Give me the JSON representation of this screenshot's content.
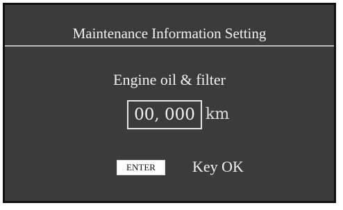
{
  "screen": {
    "title": "Maintenance Information Setting",
    "item_label": "Engine oil & filter",
    "distance_value": "00, 000",
    "distance_unit": "km",
    "enter_key_label": "ENTER",
    "enter_hint": "Key OK"
  },
  "colors": {
    "background": "#3b3b3b",
    "text": "#f2f2f2",
    "key_background": "#ffffff"
  }
}
